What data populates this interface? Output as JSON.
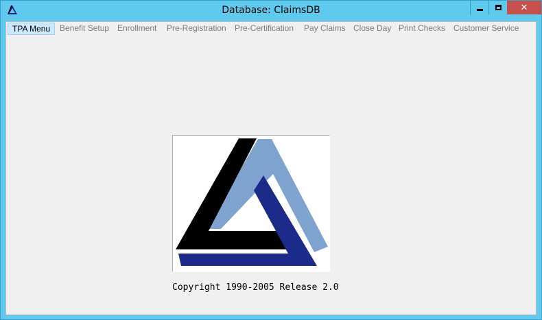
{
  "window": {
    "title": "Database: ClaimsDB",
    "accent_color": "#60c9ee",
    "close_color": "#c7504a",
    "icons": {
      "app": "triangle-logo-icon",
      "minimize": "minimize-icon",
      "maximize": "maximize-icon",
      "close": "close-icon"
    },
    "close_glyph": "✕"
  },
  "menu": {
    "items": [
      {
        "label": "TPA Menu",
        "active": true
      },
      {
        "label": "Benefit Setup",
        "active": false
      },
      {
        "label": "Enrollment",
        "active": false
      },
      {
        "label": "Pre-Registration",
        "active": false
      },
      {
        "label": "Pre-Certification",
        "active": false
      },
      {
        "label": "Pay Claims",
        "active": false
      },
      {
        "label": "Close Day",
        "active": false
      },
      {
        "label": "Print Checks",
        "active": false
      },
      {
        "label": "Customer Service",
        "active": false
      }
    ]
  },
  "main": {
    "logo": {
      "name": "company-triangle-logo",
      "colors": [
        "#000000",
        "#7fa3cf",
        "#1c2a8a"
      ]
    },
    "copyright": "Copyright 1990-2005 Release 2.0"
  }
}
